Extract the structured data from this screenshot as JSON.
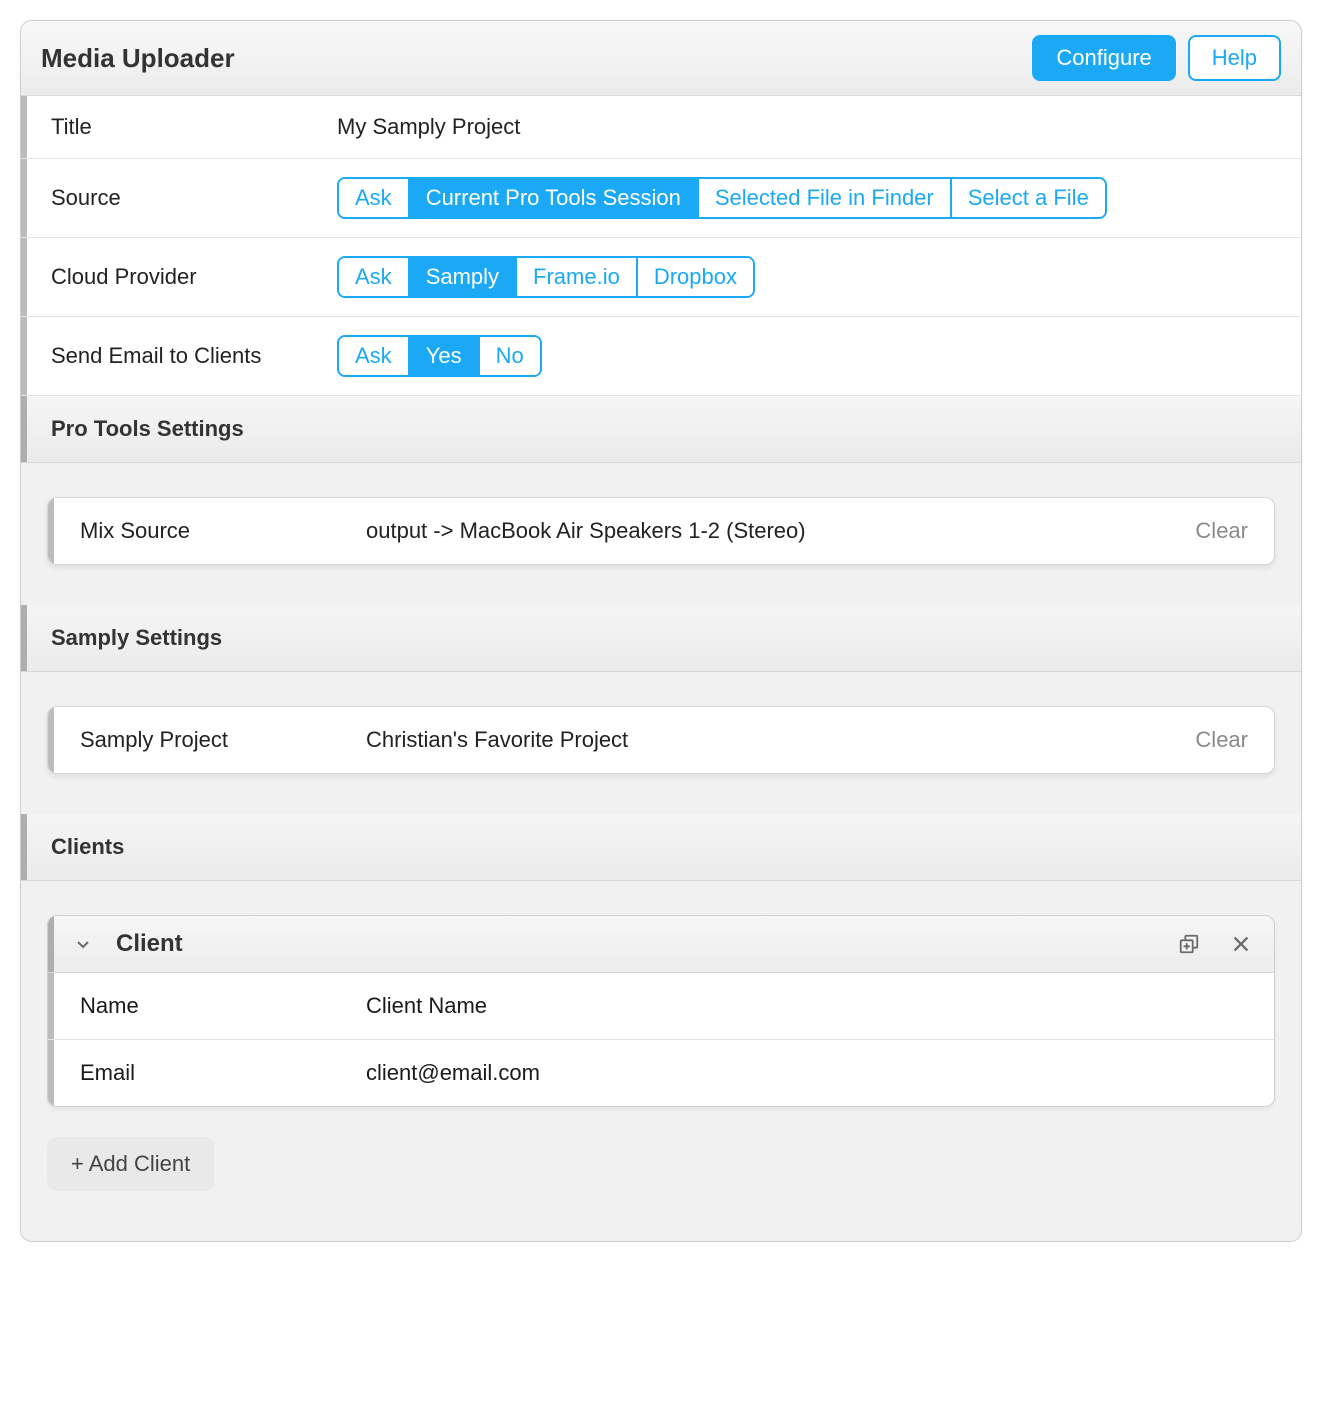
{
  "header": {
    "title": "Media Uploader",
    "configure": "Configure",
    "help": "Help"
  },
  "rows": {
    "title_label": "Title",
    "title_value": "My Samply Project",
    "source_label": "Source",
    "source_options": [
      "Ask",
      "Current Pro Tools Session",
      "Selected File in Finder",
      "Select a File"
    ],
    "source_selected": "Current Pro Tools Session",
    "cloud_label": "Cloud Provider",
    "cloud_options": [
      "Ask",
      "Samply",
      "Frame.io",
      "Dropbox"
    ],
    "cloud_selected": "Samply",
    "email_label": "Send Email to Clients",
    "email_options": [
      "Ask",
      "Yes",
      "No"
    ],
    "email_selected": "Yes"
  },
  "protools": {
    "header": "Pro Tools Settings",
    "mix_label": "Mix Source",
    "mix_value": "output -> MacBook Air Speakers 1-2 (Stereo)",
    "clear": "Clear"
  },
  "samply": {
    "header": "Samply Settings",
    "project_label": "Samply Project",
    "project_value": "Christian's Favorite Project",
    "clear": "Clear"
  },
  "clients": {
    "header": "Clients",
    "panel_title": "Client",
    "name_label": "Name",
    "name_value": "Client Name",
    "email_label": "Email",
    "email_value": "client@email.com",
    "add_button": "+ Add Client"
  }
}
